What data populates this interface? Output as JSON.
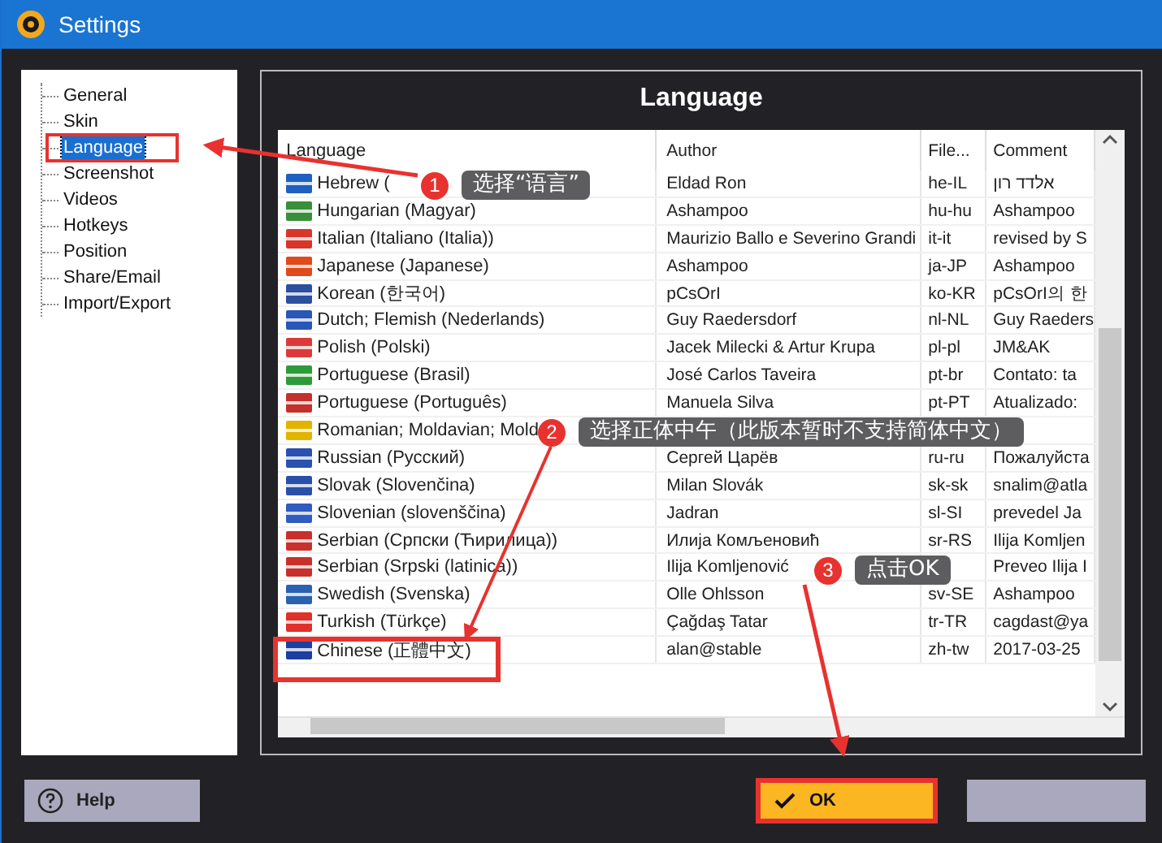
{
  "window": {
    "title": "Settings"
  },
  "sidebar": {
    "items": [
      {
        "label": "General",
        "selected": false
      },
      {
        "label": "Skin",
        "selected": false
      },
      {
        "label": "Language",
        "selected": true
      },
      {
        "label": "Screenshot",
        "selected": false
      },
      {
        "label": "Videos",
        "selected": false
      },
      {
        "label": "Hotkeys",
        "selected": false
      },
      {
        "label": "Position",
        "selected": false
      },
      {
        "label": "Share/Email",
        "selected": false
      },
      {
        "label": "Import/Export",
        "selected": false
      }
    ]
  },
  "panel": {
    "title": "Language"
  },
  "table": {
    "columns": [
      "Language",
      "Author",
      "File...",
      "Comment"
    ],
    "rows": [
      {
        "language": "Hebrew (",
        "author": "Eldad Ron",
        "file": "he-IL",
        "comment": "אלדד רון",
        "color": "#1f5fbf"
      },
      {
        "language": "Hungarian (Magyar)",
        "author": "Ashampoo",
        "file": "hu-hu",
        "comment": "Ashampoo",
        "color": "#3a8f3a"
      },
      {
        "language": "Italian (Italiano (Italia))",
        "author": "Maurizio Ballo e Severino Grandi",
        "file": "it-it",
        "comment": "revised by S",
        "color": "#d8362b"
      },
      {
        "language": "Japanese (Japanese)",
        "author": "Ashampoo",
        "file": "ja-JP",
        "comment": "Ashampoo",
        "color": "#e04a1a"
      },
      {
        "language": "Korean (한국어)",
        "author": "pCsOrI",
        "file": "ko-KR",
        "comment": "pCsOrI의 한",
        "color": "#2c4f9e"
      },
      {
        "language": "Dutch; Flemish (Nederlands)",
        "author": "Guy Raedersdorf",
        "file": "nl-NL",
        "comment": "Guy Raeders",
        "color": "#2a56b8"
      },
      {
        "language": "Polish (Polski)",
        "author": "Jacek Milecki & Artur Krupa",
        "file": "pl-pl",
        "comment": "JM&AK",
        "color": "#dc3a3a"
      },
      {
        "language": "Portuguese (Brasil)",
        "author": "José Carlos Taveira",
        "file": "pt-br",
        "comment": "Contato: ta",
        "color": "#2f9a3a"
      },
      {
        "language": "Portuguese (Português)",
        "author": "Manuela Silva",
        "file": "pt-PT",
        "comment": "Atualizado:",
        "color": "#c4302b"
      },
      {
        "language": "Romanian; Moldavian; Mold",
        "color": "#e2b400"
      },
      {
        "language": "Russian (Русский)",
        "author": "Сергей Царёв",
        "file": "ru-ru",
        "comment": "Пожалуйста",
        "color": "#2a50b0"
      },
      {
        "language": "Slovak (Slovenčina)",
        "author": "Milan Slovák",
        "file": "sk-sk",
        "comment": "snalim@atla",
        "color": "#2a4fa8"
      },
      {
        "language": "Slovenian (slovenščina)",
        "author": "Jadran",
        "file": "sl-SI",
        "comment": "prevedel Ja",
        "color": "#2f5cc0"
      },
      {
        "language": "Serbian (Српски (Ћирилица))",
        "author": "Илија Комљеновић",
        "file": "sr-RS",
        "comment": "Ilija Komljen",
        "color": "#c9302c"
      },
      {
        "language": "Serbian (Srpski (latinica))",
        "author": "Ilija Komljenović",
        "comment": "Preveo Ilija I",
        "color": "#c9302c"
      },
      {
        "language": "Swedish (Svenska)",
        "author": "Olle Ohlsson",
        "file": "sv-SE",
        "comment": "Ashampoo",
        "color": "#2a62b0"
      },
      {
        "language": "Turkish (Türkçe)",
        "author": "Çağdaş Tatar",
        "file": "tr-TR",
        "comment": "cagdast@ya",
        "color": "#e0302a"
      },
      {
        "language": "Chinese (正體中文)",
        "author": "alan@stable",
        "file": "zh-tw",
        "comment": "2017-03-25",
        "color": "#1c3fa0"
      }
    ]
  },
  "buttons": {
    "help": "Help",
    "ok": "OK"
  },
  "annotations": [
    {
      "number": "1",
      "text": "选择“语言”"
    },
    {
      "number": "2",
      "text": "选择正体中午（此版本暂时不支持简体中文）"
    },
    {
      "number": "3",
      "text": "点击OK"
    }
  ]
}
